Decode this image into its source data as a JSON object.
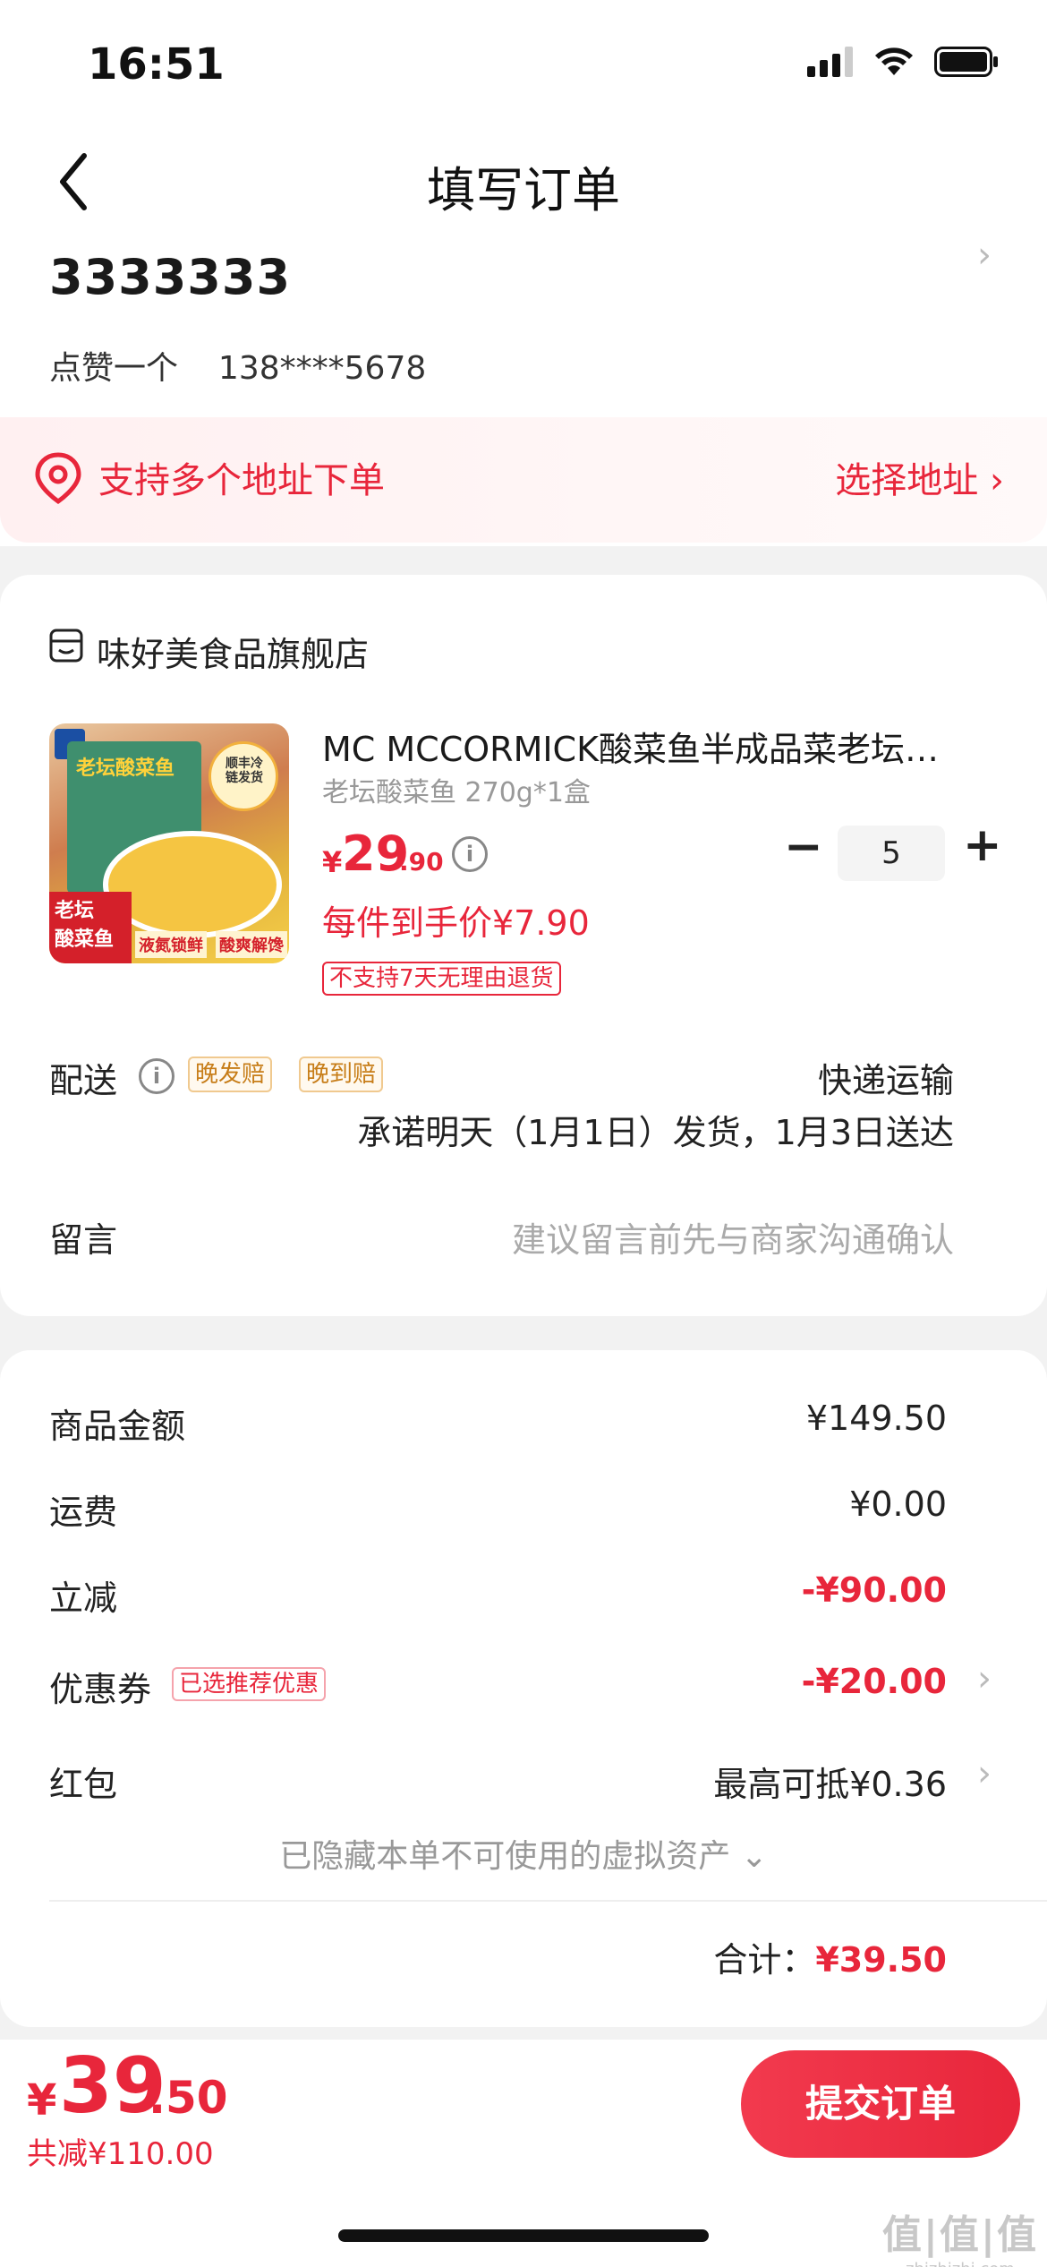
{
  "status_bar": {
    "time": "16:51"
  },
  "header": {
    "title": "填写订单"
  },
  "address": {
    "name": "3333333",
    "contact_name": "点赞一个",
    "phone": "138****5678",
    "multi_banner_text": "支持多个地址下单",
    "select_label": "选择地址 ›"
  },
  "store": {
    "name": "味好美食品旗舰店",
    "product": {
      "title": "MC MCCORMICK酸菜鱼半成品菜老坛酸菜鱼",
      "spec": "老坛酸菜鱼 270g*1盒",
      "price_symbol": "¥",
      "price_int": "29",
      "price_dec": ".90",
      "per_item_price": "每件到手价¥7.90",
      "no_return_tag": "不支持7天无理由退货",
      "quantity": "5",
      "image_text": {
        "box_title": "老坛酸菜鱼",
        "sf_badge": "顺丰冷链发货",
        "tag_main": "老坛\n酸菜鱼",
        "tag_fresh": "液氮锁鲜",
        "tag_taste": "酸爽解馋"
      }
    },
    "shipping": {
      "label": "配送",
      "tag_late_ship": "晚发赔",
      "tag_late_arrive": "晚到赔",
      "method": "快递运输",
      "promise": "承诺明天（1月1日）发货，1月3日送达"
    },
    "message": {
      "label": "留言",
      "placeholder": "建议留言前先与商家沟通确认"
    }
  },
  "summary": {
    "goods_label": "商品金额",
    "goods_value": "¥149.50",
    "freight_label": "运费",
    "freight_value": "¥0.00",
    "discount_label": "立减",
    "discount_value": "-¥90.00",
    "coupon_label": "优惠券",
    "coupon_tag": "已选推荐优惠",
    "coupon_value": "-¥20.00",
    "redpacket_label": "红包",
    "redpacket_value": "最高可抵¥0.36",
    "hidden_assets": "已隐藏本单不可使用的虚拟资产 ⌄",
    "total_label": "合计：",
    "total_value": "¥39.50"
  },
  "bottom_bar": {
    "price_symbol": "¥",
    "price_int": "39",
    "price_dec": ".50",
    "total_saved": "共减¥110.00",
    "submit_label": "提交订单"
  },
  "watermark": {
    "line1": "值|值|值",
    "line2": "zhizhizhi.com"
  },
  "colors": {
    "accent": "#e8263b",
    "tag_yellow": "#c77d18"
  }
}
